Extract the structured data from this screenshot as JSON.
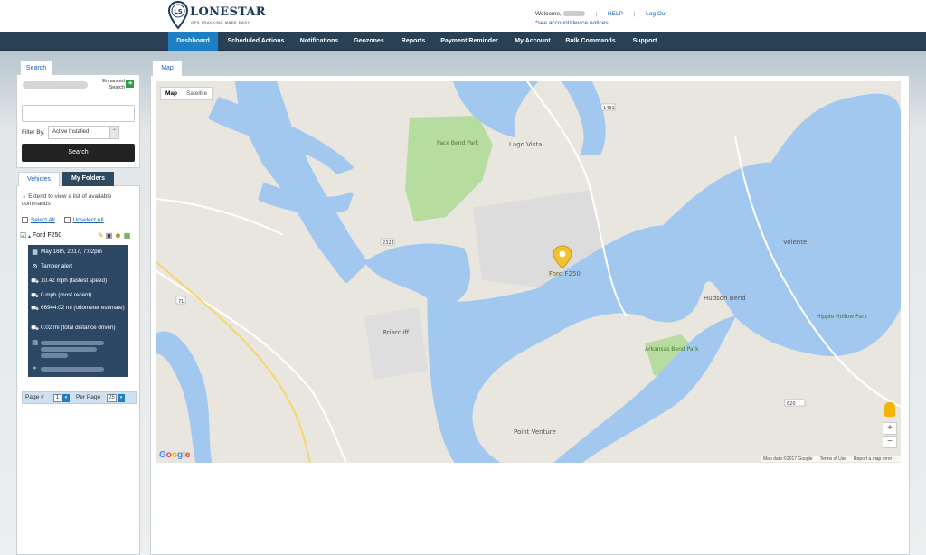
{
  "header": {
    "logo_text": "LONESTAR",
    "logo_sub": "TRACKING",
    "logo_tagline": "GPS TRACKING MADE EASY",
    "welcome_label": "Welcome,",
    "help_link": "HELP",
    "logout_link": "Log Out",
    "notice_link": "*see account/device notices"
  },
  "nav": {
    "items": [
      "Dashboard",
      "Scheduled Actions",
      "Notifications",
      "Geozones",
      "Reports",
      "Payment Reminder",
      "My Account",
      "Bulk Commands",
      "Support"
    ],
    "active": "Dashboard",
    "active_color": "#1e7fc4",
    "bar_color": "#284155"
  },
  "search_panel": {
    "tab_label": "Search",
    "enhanced_label_1": "Enhanced",
    "enhanced_label_2": "Search",
    "filter_label": "Filter By:",
    "filter_value": "Active Installed",
    "search_button": "Search"
  },
  "vehicles_panel": {
    "tabs": [
      "Vehicles",
      "My Folders"
    ],
    "extend_text": "Extend to view a list of available commands",
    "select_all": "Select All",
    "unselect_all": "Unselect All",
    "vehicle_name": "Ford F250",
    "info": {
      "datetime": "May 16th, 2017, 7:02pm",
      "alert": "Tamper alert",
      "fastest_speed": "10.42 mph (fastest speed)",
      "recent_speed": "0 mph (most recent)",
      "odometer": "66944.02 mi (odometer estimate)",
      "distance": "0.02 mi (total distance driven)"
    },
    "pager": {
      "page_label": "Page #",
      "page_value": "1",
      "per_page_label": "Per Page",
      "per_page_value": "25"
    }
  },
  "map": {
    "tab_label": "Map",
    "type_map": "Map",
    "type_satellite": "Satellite",
    "marker_label": "Ford F250",
    "water_color": "#a3c8f0",
    "land_color": "#e9e6df",
    "park_color": "#b7dca0",
    "places": [
      "Lago Vista",
      "Pace Bend Park",
      "Hudson Bend",
      "Briarcliff",
      "Point Venture",
      "Volente",
      "Arkansas Bend Park",
      "Hippie Hollow Park"
    ],
    "road_numbers": [
      "2322",
      "1431",
      "620",
      "71"
    ],
    "logo": "Google",
    "attribution": "Map data ©2017 Google",
    "terms": "Terms of Use",
    "report": "Report a map error",
    "zoom_in": "+",
    "zoom_out": "−"
  }
}
